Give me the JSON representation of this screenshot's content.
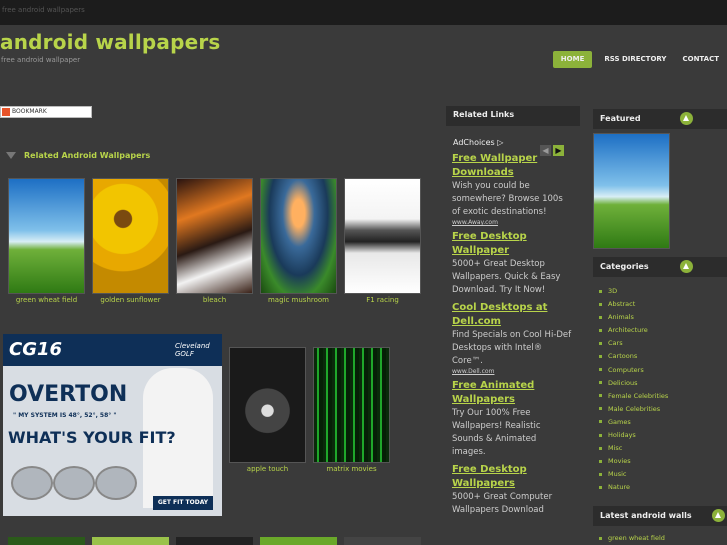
{
  "topbar": {
    "text": "free android wallpapers"
  },
  "site": {
    "title": "android wallpapers",
    "subtitle": "free android wallpaper"
  },
  "nav": [
    "HOME",
    "RSS DIRECTORY",
    "CONTACT"
  ],
  "bookmark": {
    "label": "BOOKMARK"
  },
  "related": {
    "heading": "Related Android Wallpapers",
    "items": [
      {
        "caption": "green wheat field"
      },
      {
        "caption": "golden sunflower"
      },
      {
        "caption": "bleach"
      },
      {
        "caption": "magic mushroom"
      },
      {
        "caption": "F1 racing"
      },
      {
        "caption": "apple touch"
      },
      {
        "caption": "matrix movies"
      }
    ]
  },
  "banner_ad": {
    "brand": "CG16",
    "maker": "Cleveland GOLF",
    "headline": "OVERTON",
    "quote": "\" MY SYSTEM IS 48°, 52°, 58° \"",
    "tagline": "WHAT'S YOUR FIT?",
    "cta": "GET FIT TODAY"
  },
  "related_links": {
    "heading": "Related Links",
    "adchoices": "AdChoices",
    "ads": [
      {
        "title": "Free Wallpaper Downloads",
        "desc": "Wish you could be somewhere? Browse 100s of exotic destinations!",
        "url": "www.Away.com"
      },
      {
        "title": "Free Desktop Wallpaper",
        "desc": "5000+ Great Desktop Wallpapers. Quick & Easy Download. Try It Now!",
        "url": ""
      },
      {
        "title": "Cool Desktops at Dell.com",
        "desc": "Find Specials on Cool Hi-Def Desktops with Intel® Core™.",
        "url": "www.Dell.com"
      },
      {
        "title": "Free Animated Wallpapers",
        "desc": "Try Our 100% Free Wallpapers! Realistic Sounds & Animated images.",
        "url": ""
      },
      {
        "title": "Free Desktop Wallpapers",
        "desc": "5000+ Great Computer Wallpapers Download",
        "url": ""
      }
    ]
  },
  "sidebar": {
    "featured": "Featured",
    "categories_heading": "Categories",
    "categories": [
      "3D",
      "Abstract",
      "Animals",
      "Architecture",
      "Cars",
      "Cartoons",
      "Computers",
      "Delicious",
      "Female Celebrities",
      "Male Celebrities",
      "Games",
      "Holidays",
      "Misc",
      "Movies",
      "Music",
      "Nature"
    ],
    "latest_heading": "Latest android walls",
    "latest": [
      "green wheat field"
    ]
  },
  "colors": {
    "accent": "#b8d44a",
    "button": "#8cb23a",
    "background": "#3a3a3a"
  }
}
